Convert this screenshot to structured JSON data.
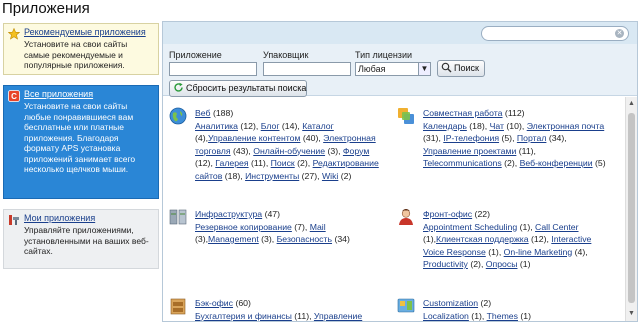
{
  "page": {
    "title": "Приложения"
  },
  "sidebar": {
    "recommended": {
      "title": "Рекомендуемые приложения",
      "desc": "Установите на свои сайты самые рекомендуемые и популярные приложения.",
      "icon": "star-icon"
    },
    "all": {
      "title": "Все приложения",
      "desc": "Установите на свои сайты любые понравившиеся вам бесплатные или платные приложения. Благодаря формату APS установка приложений занимает всего несколько щелчков мыши.",
      "icon": "aps-icon"
    },
    "my": {
      "title": "Мои приложения",
      "desc": "Управляйте приложениями, установленными на ваших веб-сайтах.",
      "icon": "tools-icon"
    }
  },
  "search": {
    "value": "",
    "placeholder": ""
  },
  "filters": {
    "app_label": "Приложение",
    "packager_label": "Упаковщик",
    "license_label": "Тип лицензии",
    "license_value": "Любая",
    "app_value": "",
    "packager_value": "",
    "search_button": "Поиск",
    "reset_button": "Сбросить результаты поиска"
  },
  "categories": [
    {
      "title": "Веб",
      "count": "(188)",
      "icon": "globe-icon",
      "items": [
        [
          "Аналитика",
          " (12), "
        ],
        [
          "Блог",
          " (14), "
        ],
        [
          "Каталог",
          " (4),"
        ],
        [
          "Управление контентом",
          " (40), "
        ],
        [
          "Электронная торговля",
          " (43), "
        ],
        [
          "Онлайн-обучение",
          " (3), "
        ],
        [
          "Форум",
          " (12), "
        ],
        [
          "Галерея",
          " (11), "
        ],
        [
          "Поиск",
          " (2), "
        ],
        [
          "Редактирование сайтов",
          " (18), "
        ],
        [
          "Инструменты",
          " (27), "
        ],
        [
          "Wiki",
          " (2)"
        ]
      ]
    },
    {
      "title": "Совместная работа",
      "count": "(112)",
      "icon": "collaboration-icon",
      "items": [
        [
          "Календарь",
          " (18), "
        ],
        [
          "Чат",
          " (10), "
        ],
        [
          "Электронная почта",
          " (31), "
        ],
        [
          "IP-телефония",
          " (5), "
        ],
        [
          "Портал",
          " (34), "
        ],
        [
          "Управление проектами",
          " (11), "
        ],
        [
          "Telecommunications",
          " (2), "
        ],
        [
          "Веб-конференции",
          " (5)"
        ]
      ]
    },
    {
      "title": "Инфраструктура",
      "count": "(47)",
      "icon": "servers-icon",
      "items": [
        [
          "Резервное копирование",
          " (7), "
        ],
        [
          "Mail",
          " (3),"
        ],
        [
          "Management",
          " (3), "
        ],
        [
          "Безопасность",
          " (34)"
        ]
      ]
    },
    {
      "title": "Фронт-офис",
      "count": "(22)",
      "icon": "person-icon",
      "items": [
        [
          "Appointment Scheduling",
          " (1), "
        ],
        [
          "Call Center",
          " (1),"
        ],
        [
          "Клиентская поддержка",
          " (12), "
        ],
        [
          "Interactive Voice Response",
          " (1), "
        ],
        [
          "On-line Marketing",
          " (4), "
        ],
        [
          "Productivity",
          " (2), "
        ],
        [
          "Опросы",
          " (1)"
        ]
      ]
    },
    {
      "title": "Бэк-офис",
      "count": "(60)",
      "icon": "cabinet-icon",
      "items": [
        [
          "Бухгалтерия и финансы",
          " (11), "
        ],
        [
          "Управление",
          ""
        ]
      ]
    },
    {
      "title": "Customization",
      "count": "(2)",
      "icon": "customization-icon",
      "items": [
        [
          "Localization",
          " (1), "
        ],
        [
          "Themes",
          " (1)"
        ]
      ]
    }
  ]
}
